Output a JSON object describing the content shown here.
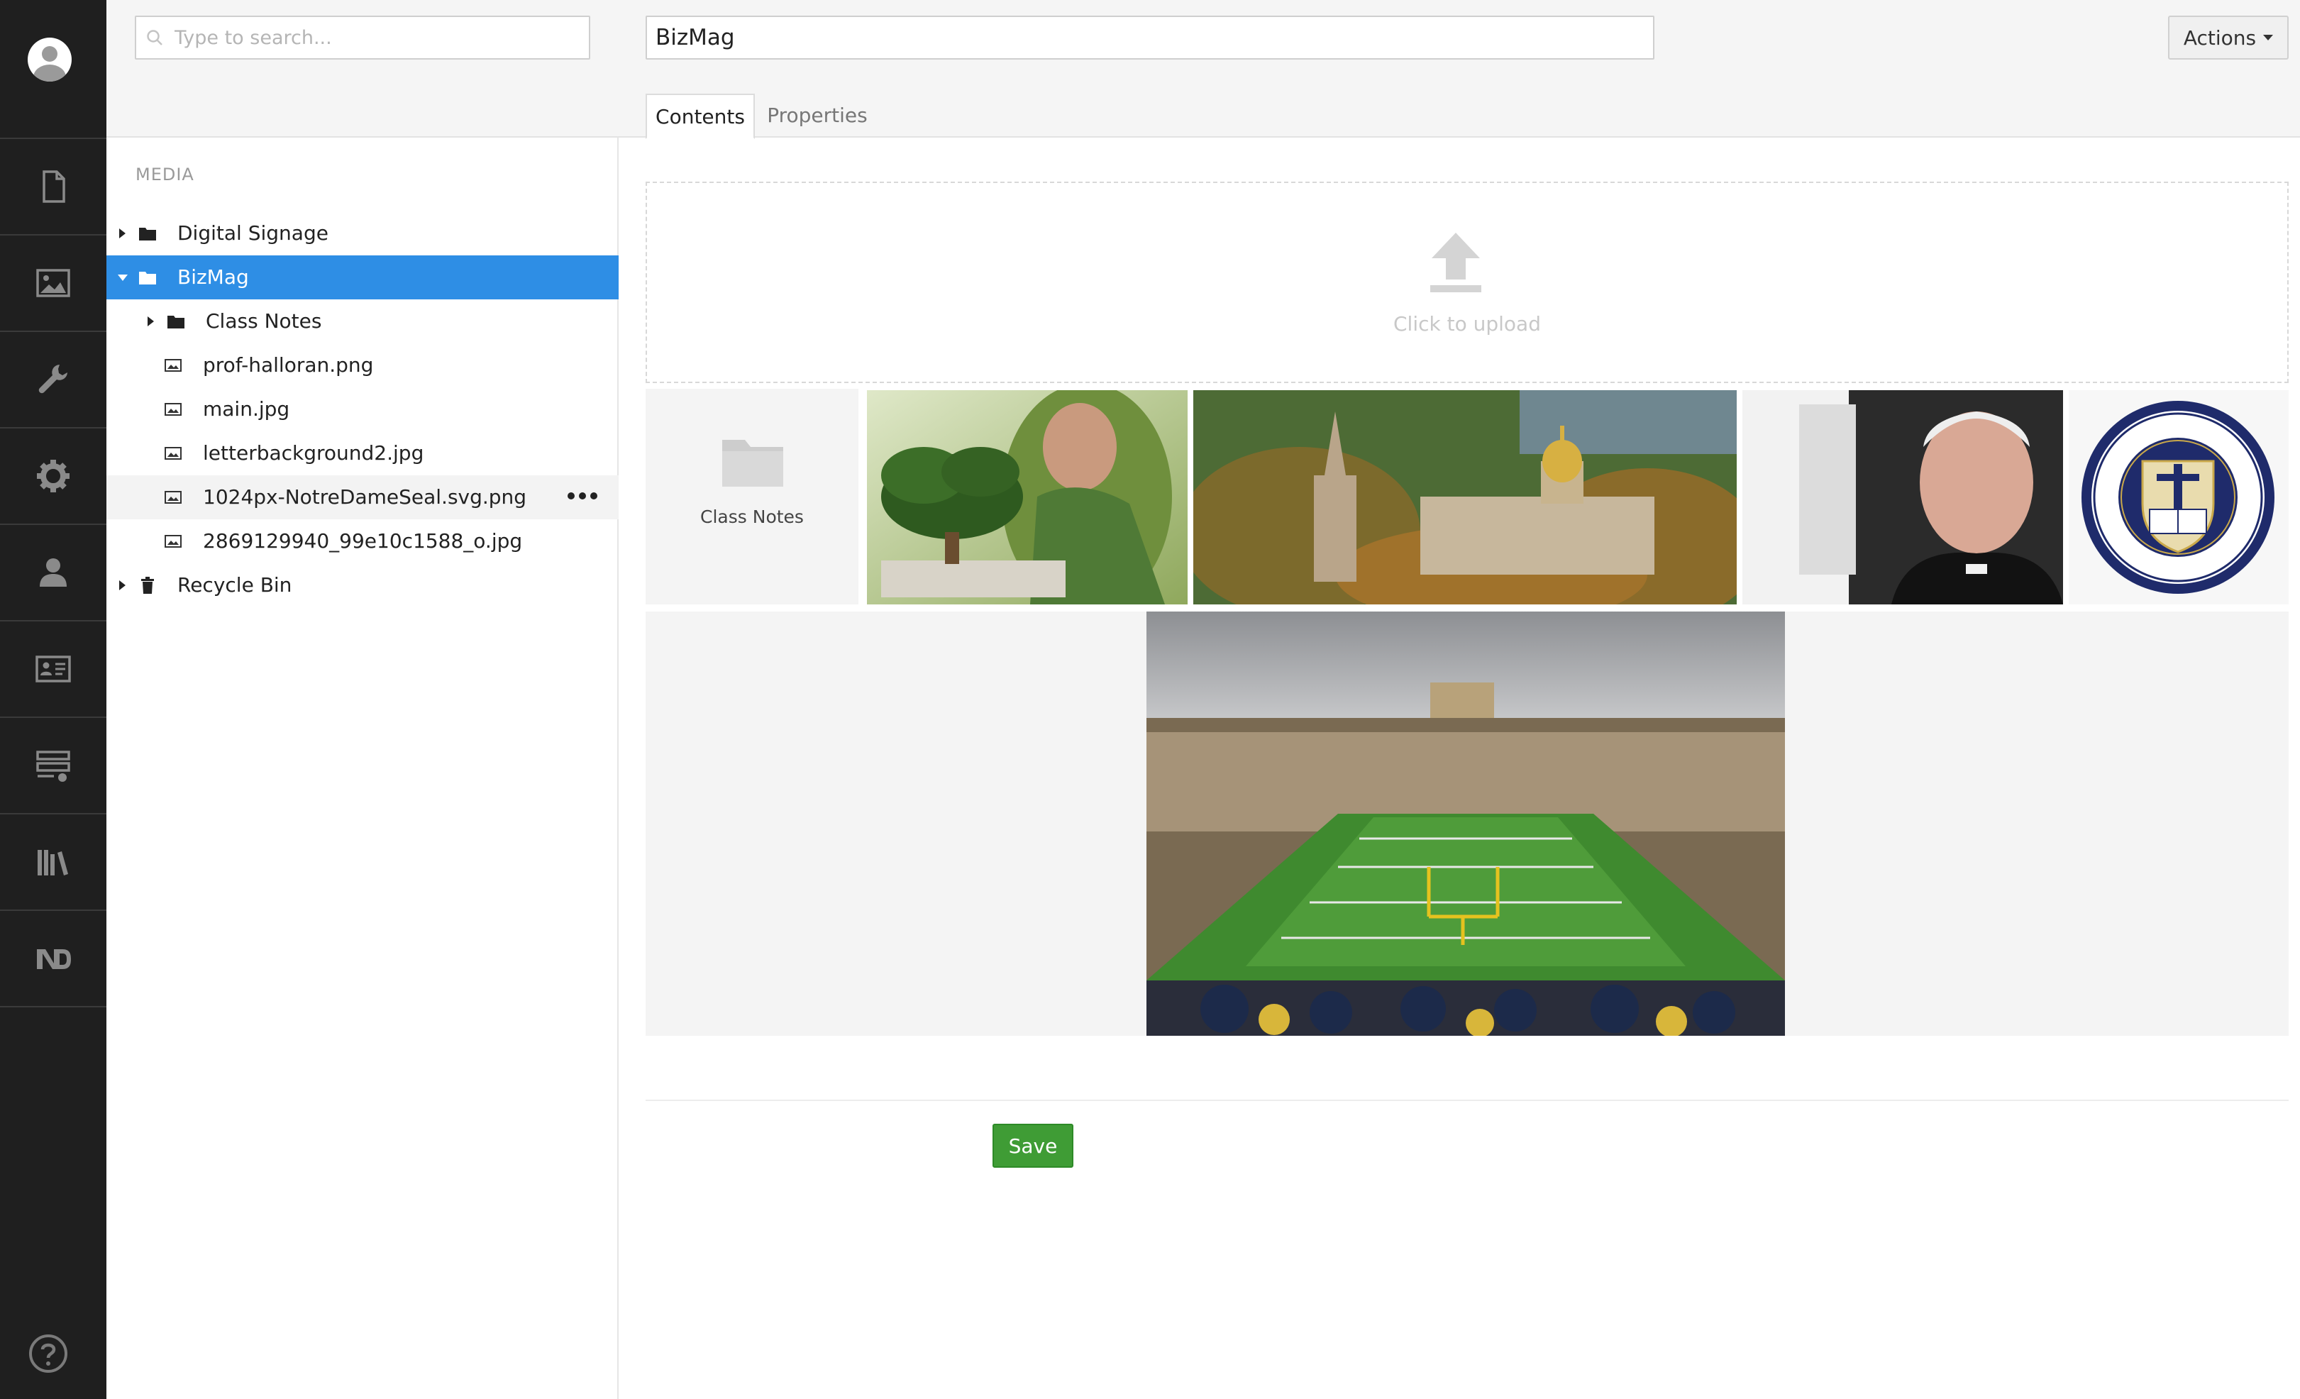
{
  "rail": {
    "items": [
      "content",
      "media",
      "settings",
      "developer",
      "users",
      "members",
      "forms",
      "translation",
      "notre-dame"
    ],
    "help_icon": "help-icon"
  },
  "tree": {
    "search_placeholder": "Type to search...",
    "section_label": "MEDIA",
    "items": [
      {
        "label": "Digital Signage",
        "type": "folder",
        "expanded": false,
        "level": 0
      },
      {
        "label": "BizMag",
        "type": "folder",
        "expanded": true,
        "selected": true,
        "level": 0
      },
      {
        "label": "Class Notes",
        "type": "folder",
        "expanded": false,
        "level": 1
      },
      {
        "label": "prof-halloran.png",
        "type": "image",
        "level": 1
      },
      {
        "label": "main.jpg",
        "type": "image",
        "level": 1
      },
      {
        "label": "letterbackground2.jpg",
        "type": "image",
        "level": 1
      },
      {
        "label": "1024px-NotreDameSeal.svg.png",
        "type": "image",
        "level": 1,
        "hovered": true
      },
      {
        "label": "2869129940_99e10c1588_o.jpg",
        "type": "image",
        "level": 1
      },
      {
        "label": "Recycle Bin",
        "type": "trash",
        "level": 0
      }
    ]
  },
  "editor": {
    "name": "BizMag",
    "actions_label": "Actions",
    "tabs": [
      {
        "label": "Contents",
        "active": true
      },
      {
        "label": "Properties",
        "active": false
      }
    ],
    "upload_text": "Click to upload",
    "folder_tile_label": "Class Notes",
    "save_label": "Save"
  },
  "colors": {
    "rail_bg": "#1f1f1f",
    "selected_bg": "#2e8ee5",
    "save_bg": "#3f9c35"
  }
}
